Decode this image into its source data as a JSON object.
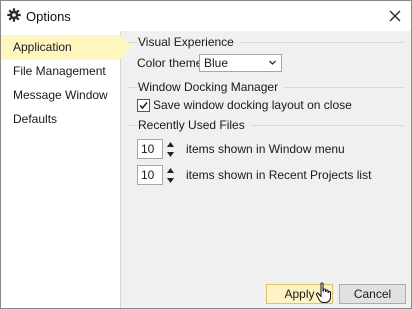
{
  "window": {
    "title": "Options",
    "title_icon": "gear-icon"
  },
  "sidebar": {
    "items": [
      {
        "label": "Application",
        "active": true
      },
      {
        "label": "File Management",
        "active": false
      },
      {
        "label": "Message Window",
        "active": false
      },
      {
        "label": "Defaults",
        "active": false
      }
    ],
    "active_color": "#fff6bf"
  },
  "visual_experience": {
    "title": "Visual Experience",
    "color_theme_label": "Color theme:",
    "color_theme_value": "Blue"
  },
  "docking": {
    "title": "Window Docking Manager",
    "save_layout_label": "Save window docking layout on close",
    "save_layout_checked": true
  },
  "recent_files": {
    "title": "Recently Used Files",
    "window_menu_value": "10",
    "window_menu_label": "items shown in Window menu",
    "recent_projects_value": "10",
    "recent_projects_label": "items shown in Recent Projects list"
  },
  "footer": {
    "apply_label": "Apply",
    "cancel_label": "Cancel"
  }
}
